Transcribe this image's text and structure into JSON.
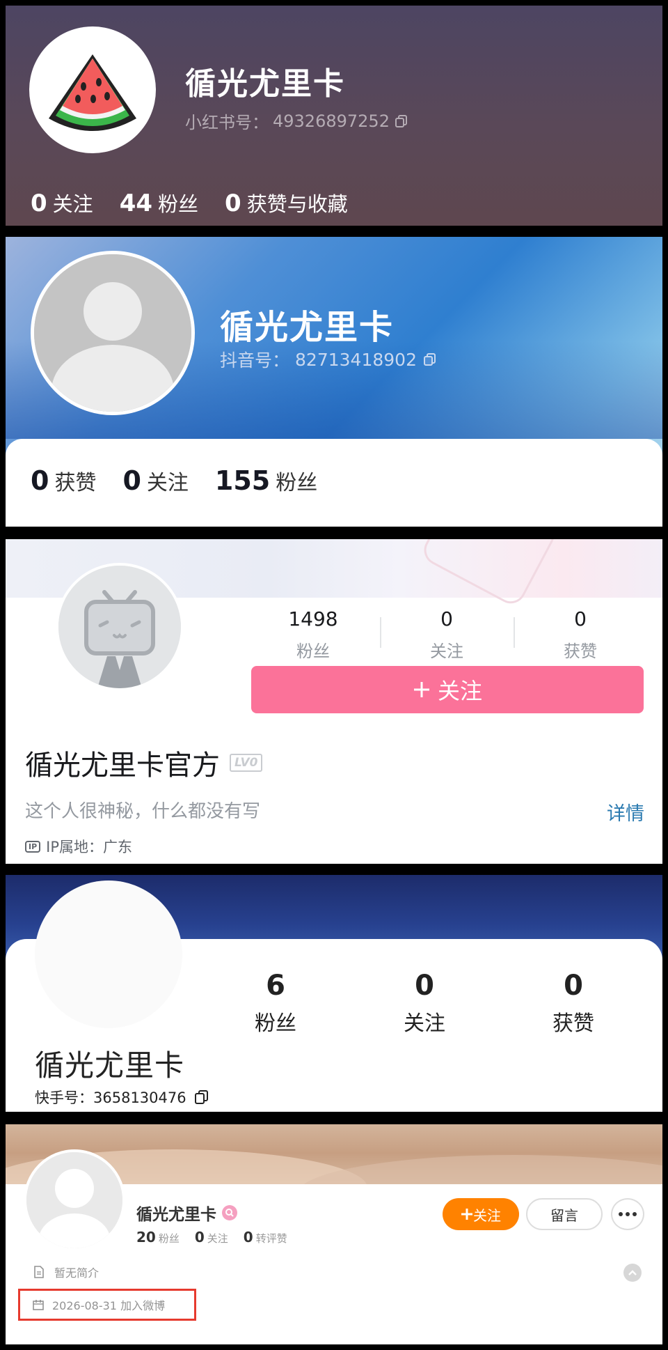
{
  "xiaohongshu": {
    "name": "循光尤里卡",
    "id_label": "小红书号：",
    "id_value": "49326897252",
    "stats": [
      {
        "num": "0",
        "label": "关注"
      },
      {
        "num": "44",
        "label": "粉丝"
      },
      {
        "num": "0",
        "label": "获赞与收藏"
      }
    ],
    "avatar_icon": "watermelon-icon"
  },
  "douyin": {
    "name": "循光尤里卡",
    "id_label": "抖音号：",
    "id_value": "82713418902",
    "stats": [
      {
        "num": "0",
        "label": "获赞"
      },
      {
        "num": "0",
        "label": "关注"
      },
      {
        "num": "155",
        "label": "粉丝"
      }
    ]
  },
  "bilibili": {
    "stats": [
      {
        "num": "1498",
        "label": "粉丝"
      },
      {
        "num": "0",
        "label": "关注"
      },
      {
        "num": "0",
        "label": "获赞"
      }
    ],
    "follow_label": "关注",
    "name": "循光尤里卡官方",
    "level": "LV0",
    "sign": "这个人很神秘，什么都没有写",
    "detail_label": "详情",
    "ip_badge": "IP",
    "ip_text": "IP属地：广东",
    "accent": "#fb7299"
  },
  "kuaishou": {
    "stats": [
      {
        "num": "6",
        "label": "粉丝"
      },
      {
        "num": "0",
        "label": "关注"
      },
      {
        "num": "0",
        "label": "获赞"
      }
    ],
    "name": "循光尤里卡",
    "id_label": "快手号：",
    "id_value": "3658130476"
  },
  "weibo": {
    "name": "循光尤里卡",
    "stats": [
      {
        "num": "20",
        "label": "粉丝"
      },
      {
        "num": "0",
        "label": "关注"
      },
      {
        "num": "0",
        "label": "转评赞"
      }
    ],
    "follow_label": "关注",
    "message_label": "留言",
    "bio": "暂无简介",
    "join_text": "2026-08-31 加入微博",
    "accent": "#ff8200",
    "highlight_color": "#e63a2e"
  }
}
